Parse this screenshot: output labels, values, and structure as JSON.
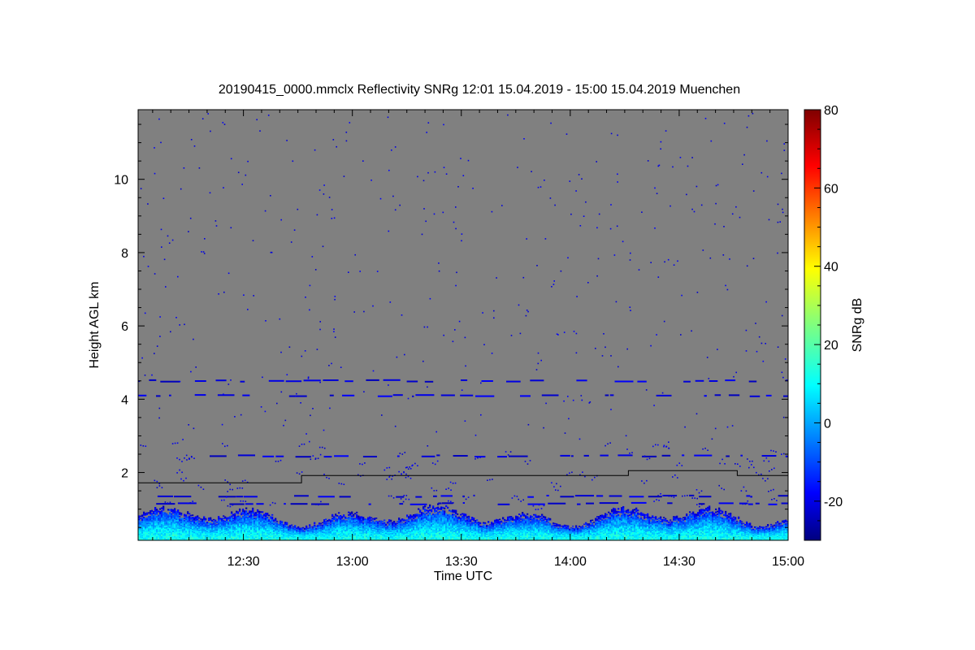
{
  "chart_data": {
    "type": "heatmap",
    "title": "20190415_0000.mmclx Reflectivity SNRg   12:01 15.04.2019 - 15:00 15.04.2019 Muenchen",
    "xlabel": "Time UTC",
    "ylabel": "Height AGL km",
    "colorbar_label": "SNRg dB",
    "xlim": [
      "12:01",
      "15:00"
    ],
    "x_ticks": [
      "12:30",
      "13:00",
      "13:30",
      "14:00",
      "14:30",
      "15:00"
    ],
    "ylim": [
      0.15,
      11.9
    ],
    "y_ticks": [
      2,
      4,
      6,
      8,
      10
    ],
    "colorbar_range": [
      -30,
      80
    ],
    "colorbar_ticks": [
      -20,
      0,
      20,
      40,
      60,
      80
    ],
    "colormap": "jet",
    "background_color": "#808080",
    "layers": [
      {
        "name": "near-surface echo",
        "bottom_km": 0.15,
        "top_km": 1.0,
        "typical_snr_db": 5
      },
      {
        "name": "weak layer",
        "height_km": 1.15,
        "typical_snr_db": -20
      },
      {
        "name": "weak layer",
        "height_km": 1.35,
        "typical_snr_db": -20
      },
      {
        "name": "weak layer",
        "height_km": 2.45,
        "typical_snr_db": -20
      },
      {
        "name": "weak layer",
        "height_km": 4.1,
        "typical_snr_db": -20
      },
      {
        "name": "weak layer",
        "height_km": 4.5,
        "typical_snr_db": -20
      }
    ],
    "boundary_line": {
      "color": "#000000",
      "points": [
        {
          "time": "12:01",
          "height_km": 1.72
        },
        {
          "time": "12:46",
          "height_km": 1.72
        },
        {
          "time": "12:46",
          "height_km": 1.92
        },
        {
          "time": "14:16",
          "height_km": 1.92
        },
        {
          "time": "14:16",
          "height_km": 2.05
        },
        {
          "time": "14:46",
          "height_km": 2.05
        },
        {
          "time": "14:46",
          "height_km": 1.92
        },
        {
          "time": "15:00",
          "height_km": 1.92
        }
      ]
    }
  }
}
